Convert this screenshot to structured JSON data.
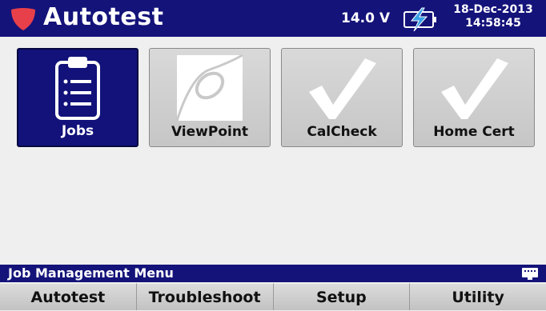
{
  "header": {
    "title": "Autotest",
    "logo_icon": "shield-icon",
    "voltage": "14.0 V",
    "battery_icon": "battery-charging-icon",
    "date": "18-Dec-2013",
    "time": "14:58:45",
    "bar_color": "#14137a"
  },
  "tiles": [
    {
      "label": "Jobs",
      "icon": "clipboard-icon",
      "selected": true
    },
    {
      "label": "ViewPoint",
      "icon": "viewpoint-icon",
      "selected": false
    },
    {
      "label": "CalCheck",
      "icon": "checkmark-icon",
      "selected": false
    },
    {
      "label": "Home Cert",
      "icon": "checkmark-icon",
      "selected": false
    }
  ],
  "status": {
    "text": "Job Management Menu",
    "icon": "keyboard-icon"
  },
  "softkeys": [
    {
      "label": "Autotest"
    },
    {
      "label": "Troubleshoot"
    },
    {
      "label": "Setup"
    },
    {
      "label": "Utility"
    }
  ],
  "colors": {
    "accent": "#14137a",
    "selected_tile": "#12127a",
    "shield": "#e8404a",
    "background": "#efefef"
  }
}
